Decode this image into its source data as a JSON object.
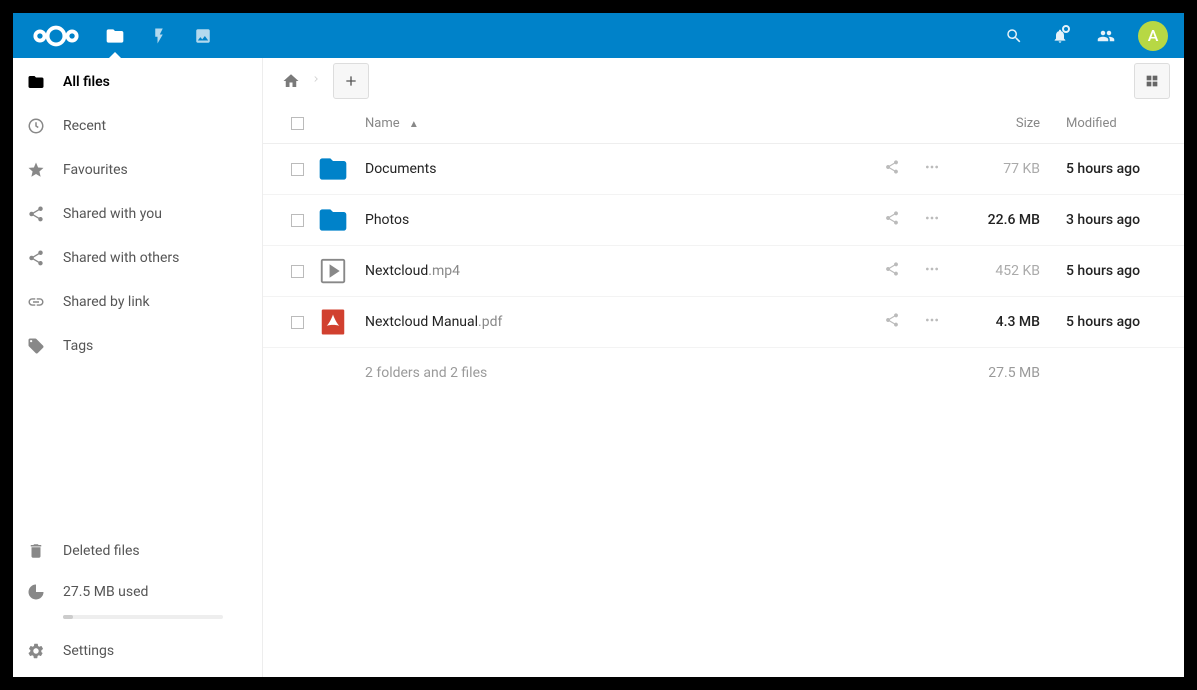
{
  "header": {
    "avatar_letter": "A"
  },
  "sidebar": {
    "items": [
      {
        "label": "All files"
      },
      {
        "label": "Recent"
      },
      {
        "label": "Favourites"
      },
      {
        "label": "Shared with you"
      },
      {
        "label": "Shared with others"
      },
      {
        "label": "Shared by link"
      },
      {
        "label": "Tags"
      }
    ],
    "bottom": {
      "deleted": "Deleted files",
      "quota": "27.5 MB used",
      "settings": "Settings"
    }
  },
  "table": {
    "headers": {
      "name": "Name",
      "size": "Size",
      "modified": "Modified"
    },
    "rows": [
      {
        "name": "Documents",
        "ext": "",
        "type": "folder",
        "size": "77 KB",
        "size_dim": true,
        "modified": "5 hours ago"
      },
      {
        "name": "Photos",
        "ext": "",
        "type": "folder",
        "size": "22.6 MB",
        "size_dim": false,
        "modified": "3 hours ago"
      },
      {
        "name": "Nextcloud",
        "ext": ".mp4",
        "type": "video",
        "size": "452 KB",
        "size_dim": true,
        "modified": "5 hours ago"
      },
      {
        "name": "Nextcloud Manual",
        "ext": ".pdf",
        "type": "pdf",
        "size": "4.3 MB",
        "size_dim": false,
        "modified": "5 hours ago"
      }
    ],
    "summary": {
      "text": "2 folders and 2 files",
      "size": "27.5 MB"
    }
  }
}
